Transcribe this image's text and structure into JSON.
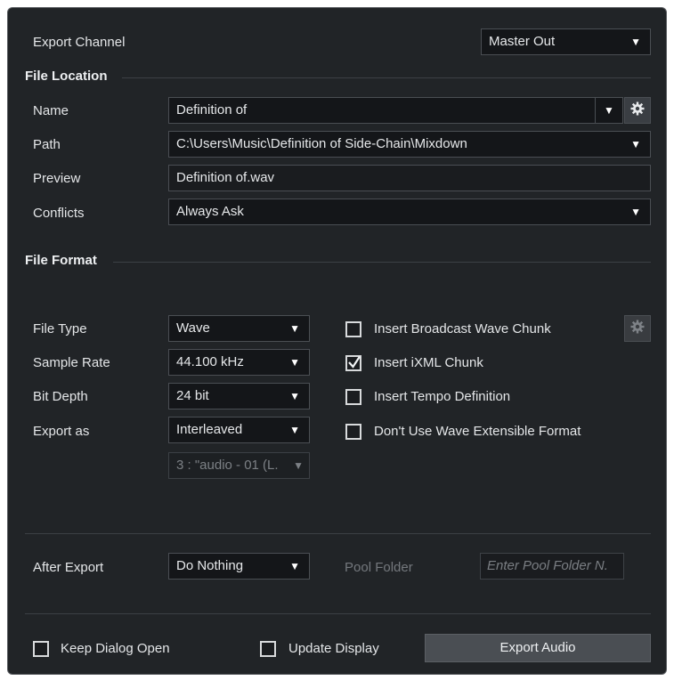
{
  "export_channel": {
    "label": "Export Channel",
    "value": "Master Out"
  },
  "file_location": {
    "title": "File Location",
    "name": {
      "label": "Name",
      "value": "Definition of"
    },
    "path": {
      "label": "Path",
      "value": "C:\\Users\\Music\\Definition of Side-Chain\\Mixdown"
    },
    "preview": {
      "label": "Preview",
      "value": "Definition of.wav"
    },
    "conflicts": {
      "label": "Conflicts",
      "value": "Always Ask"
    }
  },
  "file_format": {
    "title": "File Format",
    "file_type": {
      "label": "File Type",
      "value": "Wave"
    },
    "sample_rate": {
      "label": "Sample Rate",
      "value": "44.100 kHz"
    },
    "bit_depth": {
      "label": "Bit Depth",
      "value": "24 bit"
    },
    "export_as": {
      "label": "Export as",
      "value": "Interleaved"
    },
    "channel_select": {
      "value": "3 : \"audio - 01 (L."
    },
    "options": [
      {
        "label": "Insert Broadcast Wave Chunk",
        "checked": false
      },
      {
        "label": "Insert iXML Chunk",
        "checked": true
      },
      {
        "label": "Insert Tempo Definition",
        "checked": false
      },
      {
        "label": "Don't Use Wave Extensible Format",
        "checked": false
      }
    ]
  },
  "after_export": {
    "label": "After Export",
    "value": "Do Nothing",
    "pool_folder_label": "Pool Folder",
    "pool_folder_placeholder": "Enter Pool Folder N."
  },
  "footer": {
    "keep_dialog_open": {
      "label": "Keep Dialog Open",
      "checked": false
    },
    "update_display": {
      "label": "Update Display",
      "checked": false
    },
    "export_button": "Export Audio"
  },
  "icons": {
    "dropdown_arrow": "triangle-down-icon",
    "settings": "gear-icon",
    "checkmark": "checkmark-icon"
  },
  "colors": {
    "dialog_bg": "#212427",
    "field_bg": "#141619",
    "button_bg": "#4a4e53",
    "text": "#e4e6e8"
  }
}
